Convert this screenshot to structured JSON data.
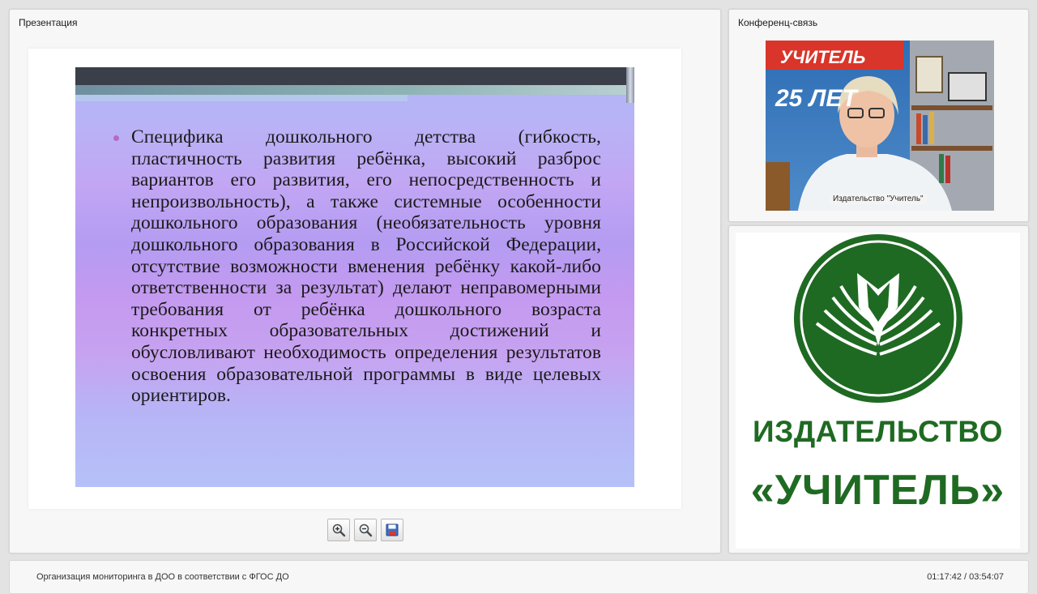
{
  "presentation": {
    "title": "Презентация",
    "slide_text": "Специфика дошкольного детства (гибкость, пластичность развития ребёнка, высокий разброс вариантов его развития, его непосредственность и непроизвольность), а также системные особенности дошкольного образования (необязательность уровня дошкольного образования в Российской Федерации, отсутствие возможности вменения ребёнку какой-либо ответственности за результат) делают неправомерными требования от ребёнка дошкольного возраста конкретных образовательных достижений и обусловливают необходимость определения результатов освоения образовательной программы в виде целевых ориентиров.",
    "toolbar": {
      "zoom_in_icon": "zoom-in-icon",
      "zoom_out_icon": "zoom-out-icon",
      "save_icon": "save-icon"
    }
  },
  "conference": {
    "title": "Конференц-связь",
    "video_caption": "Издательство \"Учитель\"",
    "banner_text": "УЧИТЕЛЬ",
    "banner_years": "25 ЛЕТ"
  },
  "logo": {
    "line1": "ИЗДАТЕЛЬСТВО",
    "line2": "«УЧИТЕЛЬ»",
    "color": "#1f6a22"
  },
  "footer": {
    "lecture_title": "Организация мониторинга в ДОО в соответствии с ФГОС ДО",
    "timecode": "01:17:42 / 03:54:07"
  }
}
